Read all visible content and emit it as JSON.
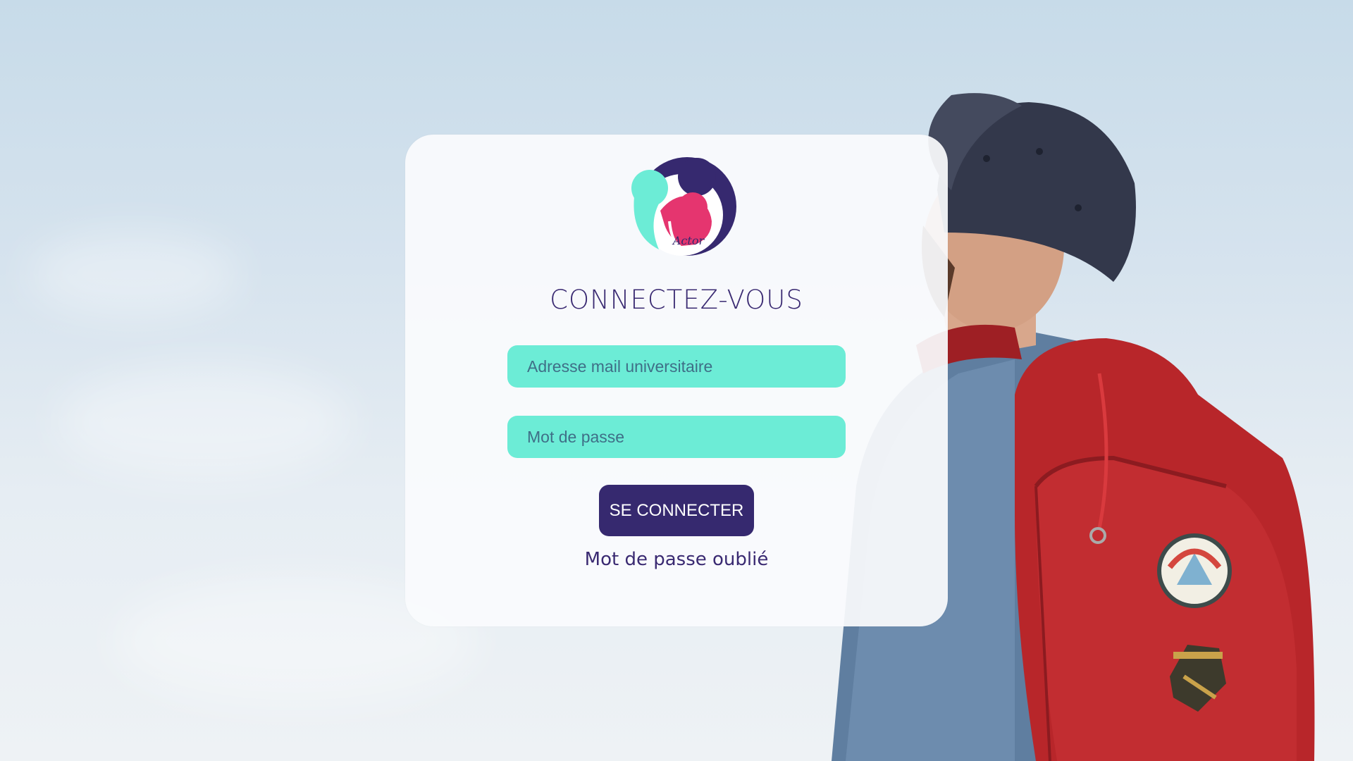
{
  "login": {
    "logo_text": "Actor",
    "title": "CONNECTEZ-VOUS",
    "email_placeholder": "Adresse mail universitaire",
    "password_placeholder": "Mot de passe",
    "submit_label": "SE CONNECTER",
    "forgot_label": "Mot de passe oublié"
  },
  "colors": {
    "primary": "#36296f",
    "input_bg": "#6cecd6",
    "accent_pink": "#e5356f",
    "accent_teal": "#6cecd6"
  },
  "icons": [
    "actor-logo-icon"
  ]
}
